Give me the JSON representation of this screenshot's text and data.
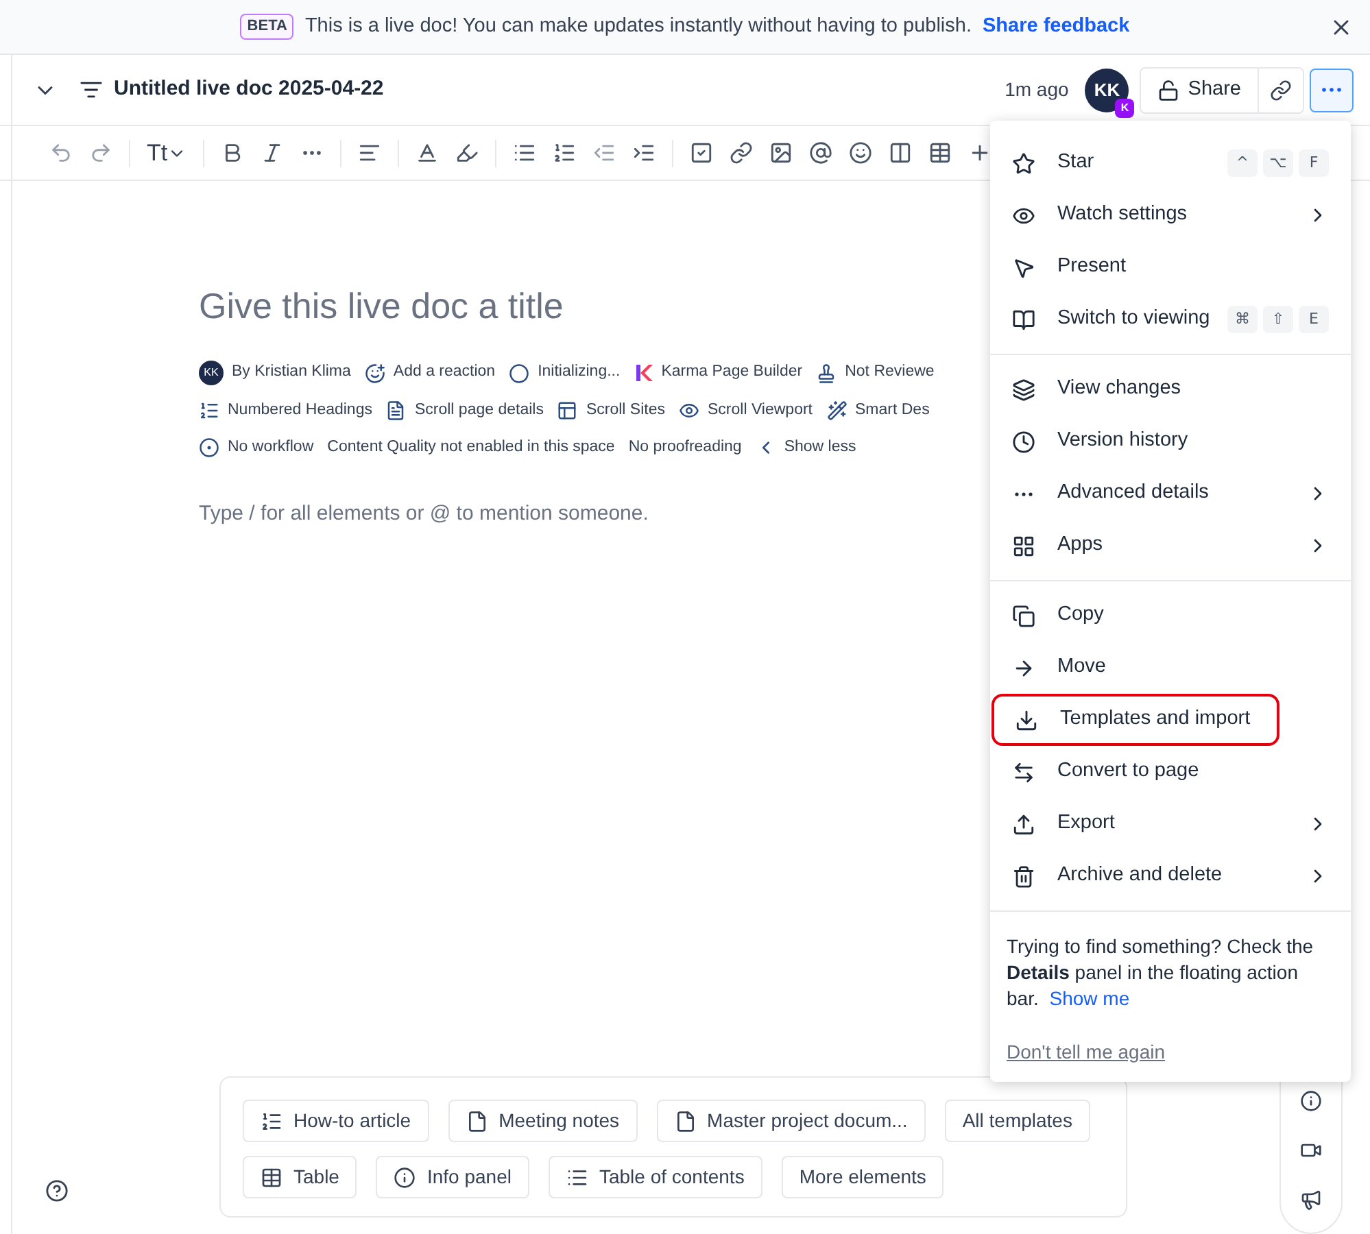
{
  "banner": {
    "badge": "BETA",
    "message": "This is a live doc! You can make updates instantly without having to publish.",
    "link": "Share feedback"
  },
  "header": {
    "title": "Untitled live doc 2025-04-22",
    "updated": "1m ago",
    "avatar": "KK",
    "avatar_badge": "K",
    "share": "Share"
  },
  "toolbar": {
    "text_style": "Tt"
  },
  "doc": {
    "title_placeholder": "Give this live doc a title",
    "byline_avatar": "KK",
    "meta_rows": [
      [
        "By Kristian Klima",
        "Add a reaction",
        "Initializing...",
        "Karma Page Builder",
        "Not Reviewe"
      ],
      [
        "Numbered Headings",
        "Scroll page details",
        "Scroll Sites",
        "Scroll Viewport",
        "Smart Des"
      ],
      [
        "No workflow",
        "Content Quality not enabled in this space",
        "No proofreading",
        "Show less"
      ]
    ],
    "body_placeholder": "Type / for all elements or @ to mention someone."
  },
  "menu": {
    "groups": [
      [
        {
          "label": "Star",
          "keys": [
            "^",
            "⌥",
            "F"
          ],
          "submenu": false,
          "outlined": false
        },
        {
          "label": "Watch settings",
          "submenu": true,
          "outlined": false
        },
        {
          "label": "Present",
          "submenu": false,
          "outlined": false
        },
        {
          "label": "Switch to viewing",
          "keys": [
            "⌘",
            "⇧",
            "E"
          ],
          "submenu": false,
          "outlined": false
        }
      ],
      [
        {
          "label": "View changes",
          "submenu": false,
          "outlined": false
        },
        {
          "label": "Version history",
          "submenu": false,
          "outlined": false
        },
        {
          "label": "Advanced details",
          "submenu": true,
          "outlined": false
        },
        {
          "label": "Apps",
          "submenu": true,
          "outlined": false
        }
      ],
      [
        {
          "label": "Copy",
          "submenu": false,
          "outlined": false
        },
        {
          "label": "Move",
          "submenu": false,
          "outlined": false
        },
        {
          "label": "Templates and import",
          "submenu": false,
          "outlined": true
        },
        {
          "label": "Convert to page",
          "submenu": false,
          "outlined": false
        },
        {
          "label": "Export",
          "submenu": true,
          "outlined": false
        },
        {
          "label": "Archive and delete",
          "submenu": true,
          "outlined": false
        }
      ]
    ],
    "tip": "Trying to find something? Check the **Details** panel in the floating action bar.",
    "tip_link": "Show me",
    "dismiss": "Don't tell me again"
  },
  "templates": [
    [
      "How-to article",
      "Meeting notes",
      "Master project docum...",
      "All templates"
    ],
    [
      "Table",
      "Info panel",
      "Table of contents",
      "More elements"
    ]
  ]
}
